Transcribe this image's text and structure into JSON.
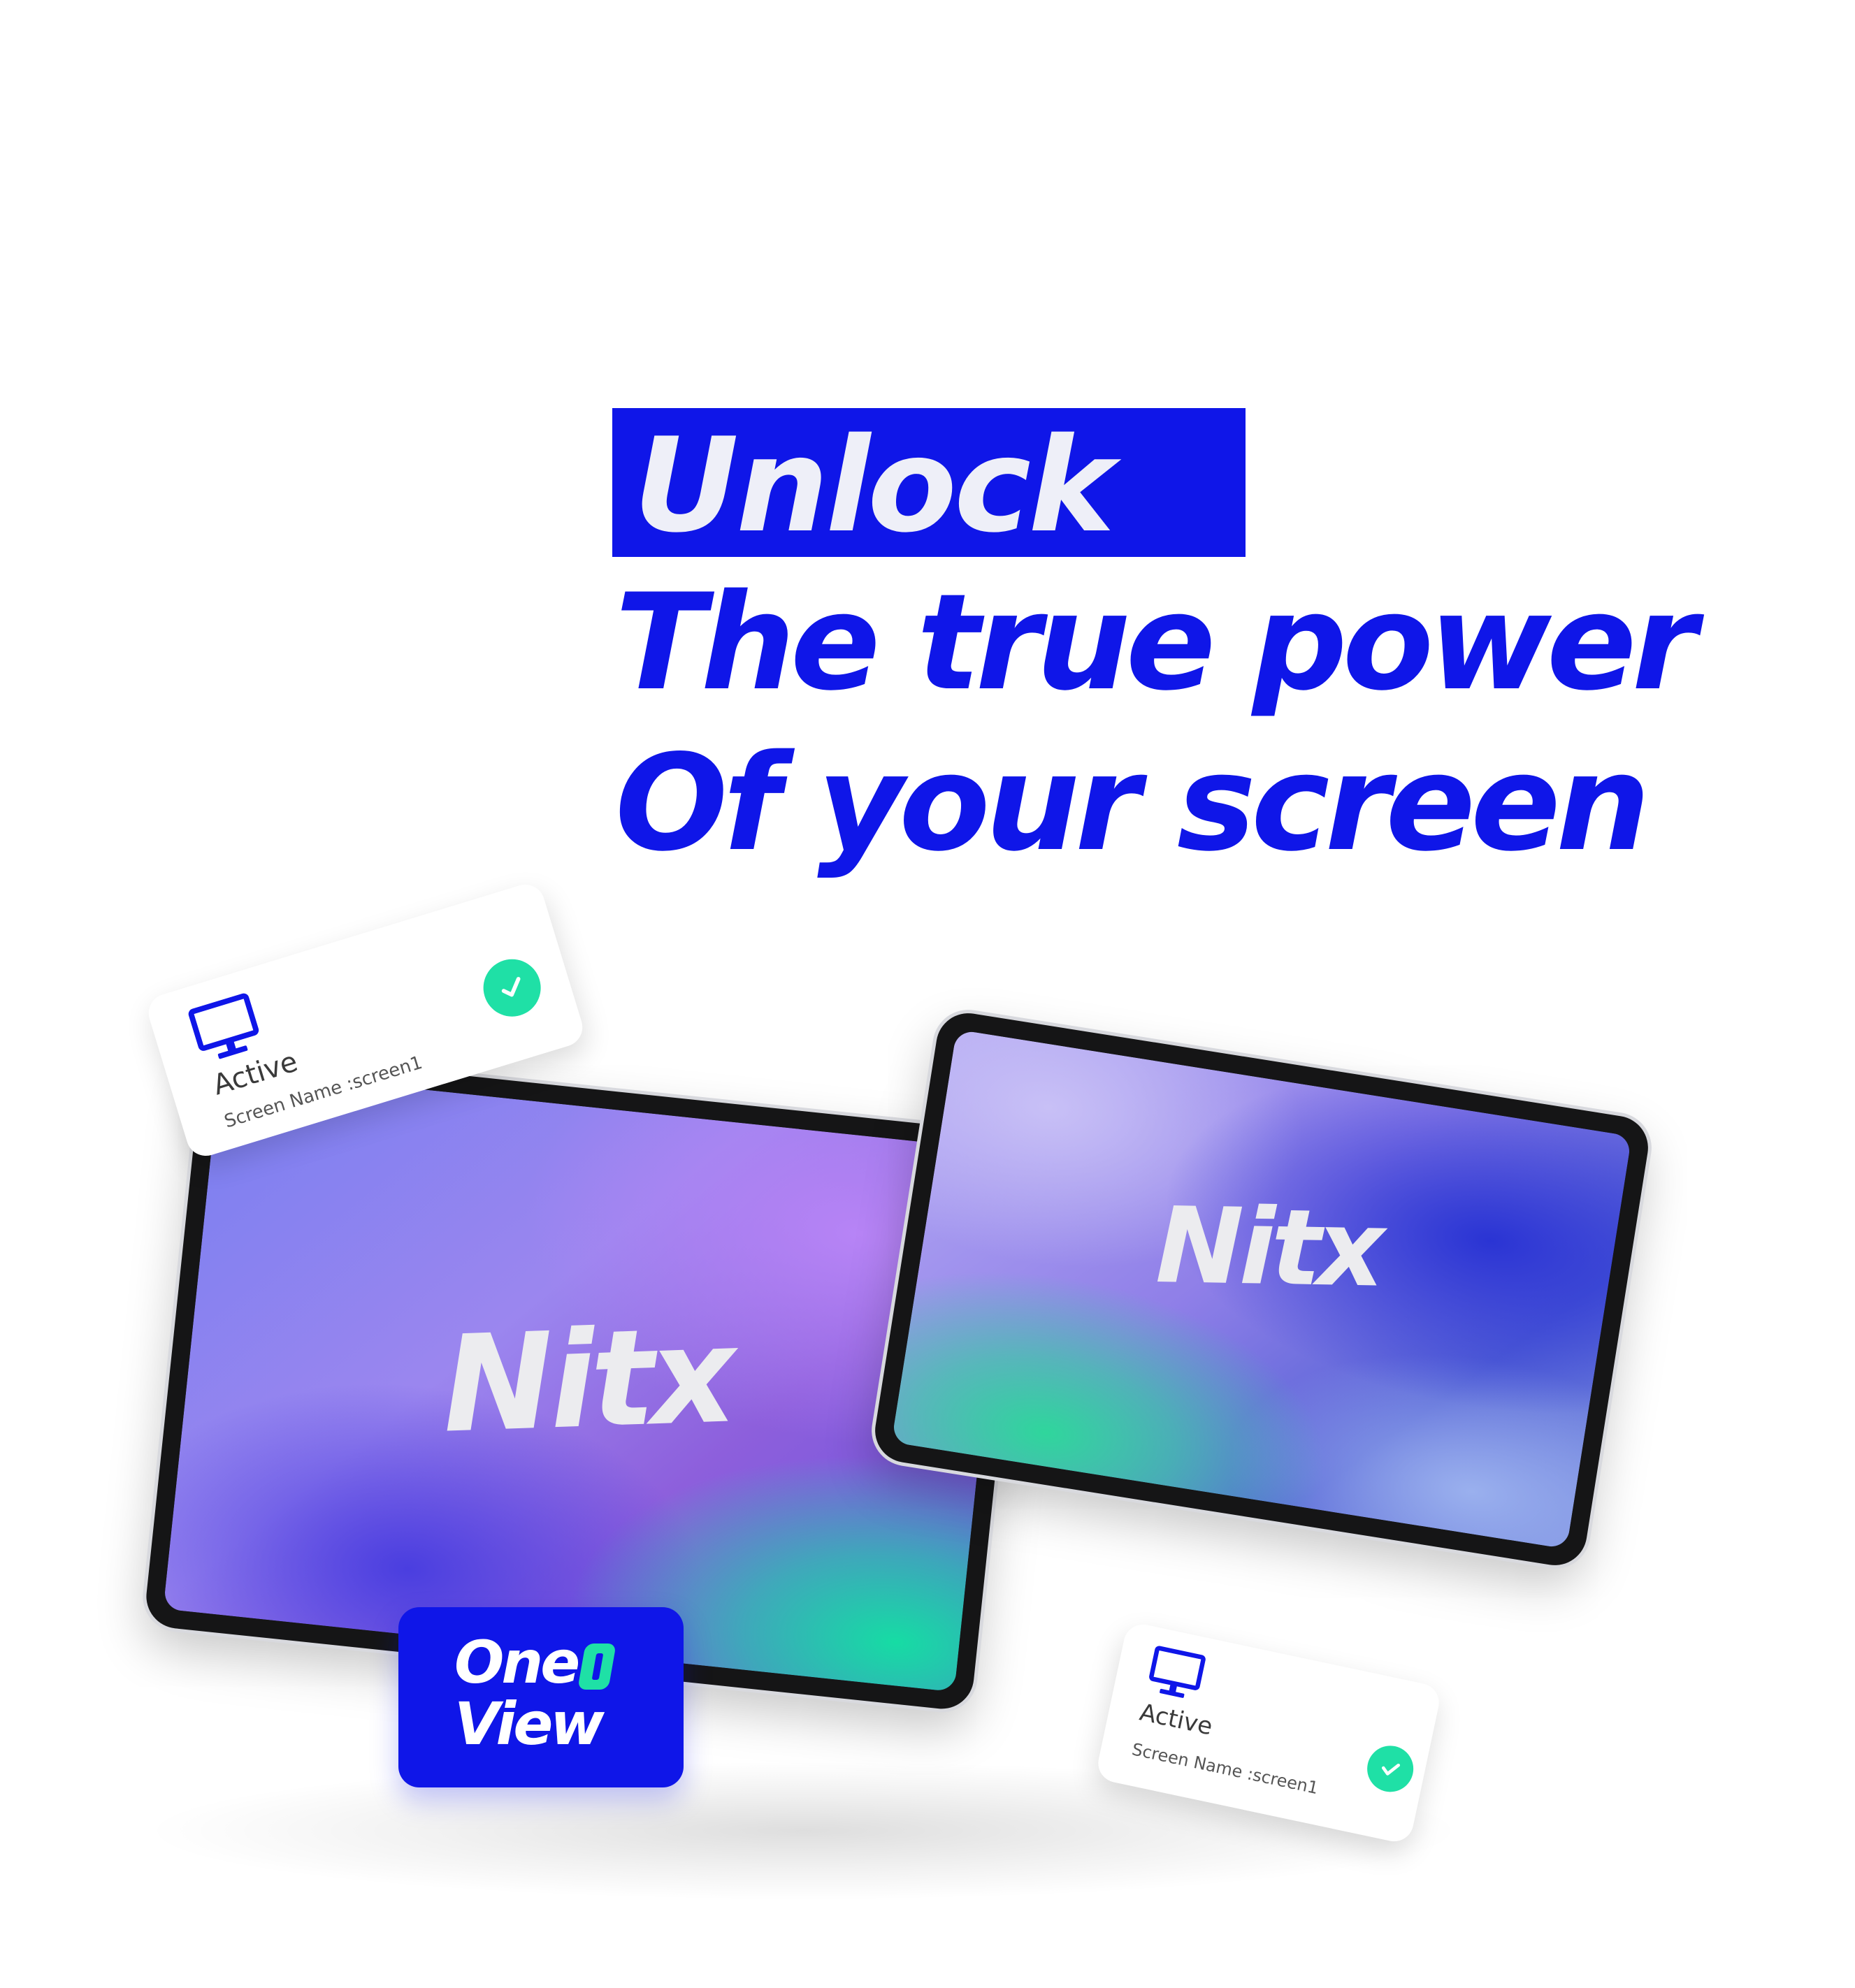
{
  "headline": {
    "line1": "Unlock",
    "line2": "The true power",
    "line3": "Of your screen"
  },
  "tablets": [
    {
      "logo_text": "Nitx"
    },
    {
      "logo_text": "Nitx"
    }
  ],
  "status_cards": [
    {
      "status": "Active",
      "screen_name": "Screen Name :screen1",
      "icon": "monitor-icon",
      "badge_icon": "check-icon"
    },
    {
      "status": "Active",
      "screen_name": "Screen Name :screen1",
      "icon": "monitor-icon",
      "badge_icon": "check-icon"
    }
  ],
  "brand_badge": {
    "line1": "One",
    "line2": "View"
  },
  "colors": {
    "brand_blue": "#0f16e8",
    "accent_green": "#1fe0a6",
    "headline_highlight_text": "#eeeff8"
  }
}
